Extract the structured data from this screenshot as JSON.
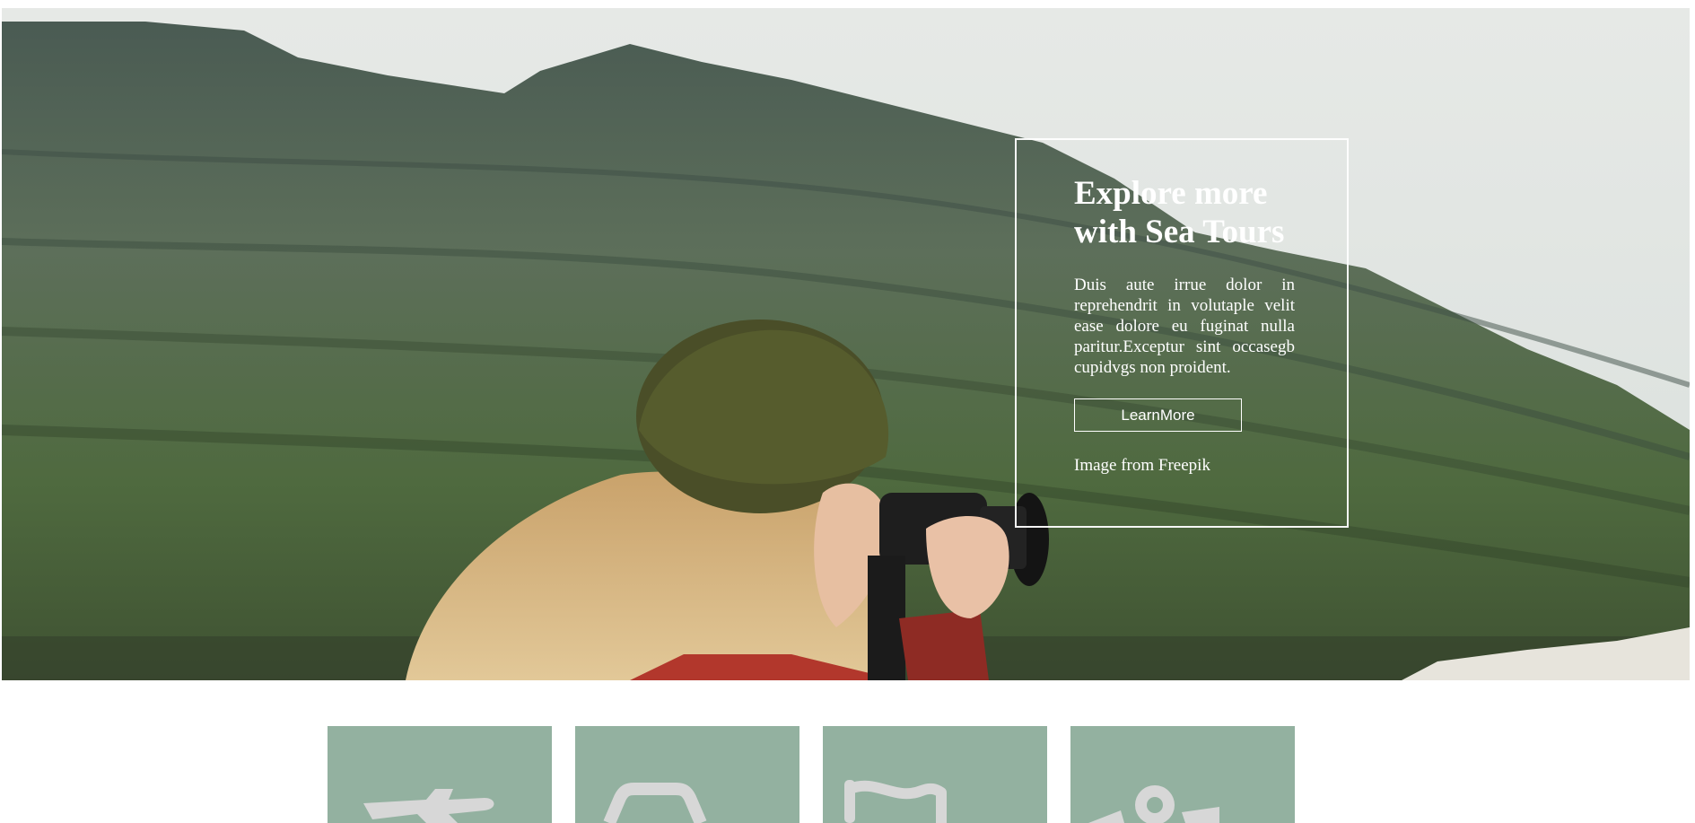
{
  "hero": {
    "title": "Explore more with Sea Tours",
    "text": "Duis aute irrue dolor in reprehendrit in volutaple velit ease dolore eu fuginat nulla paritur.Exceptur sint occasegb cupidvgs non proident.",
    "button_label": "LearnMore",
    "credit": "Image from Freepik"
  },
  "tiles": [
    {
      "icon": "airplane-icon"
    },
    {
      "icon": "ship-icon"
    },
    {
      "icon": "flag-icon"
    },
    {
      "icon": "location-pin-icon"
    }
  ],
  "colors": {
    "tile_bg": "#93b1a0",
    "icon_color": "#d7d7d7",
    "card_border": "#ffffff"
  }
}
